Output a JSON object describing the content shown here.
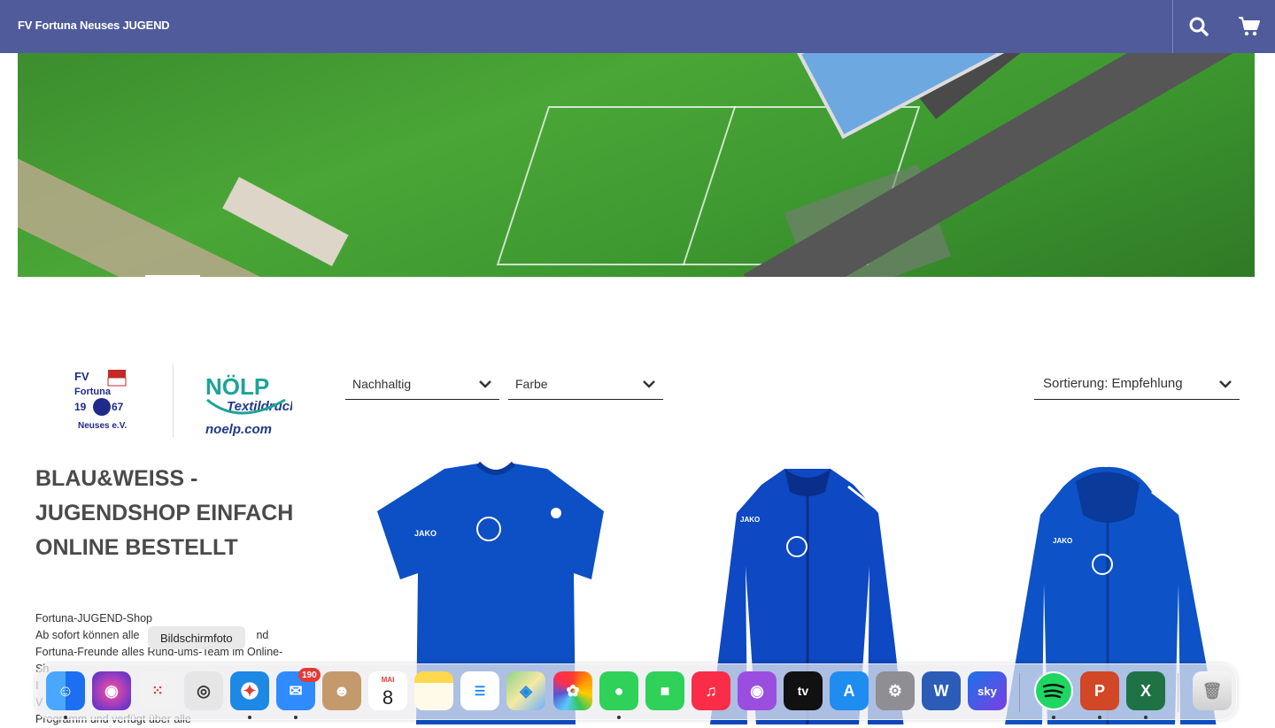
{
  "header": {
    "brand": "FV Fortuna Neuses JUGEND",
    "search_icon": "search-icon",
    "cart_icon": "cart-icon",
    "color": "#505b9c"
  },
  "logos": {
    "club_lines": [
      "FV",
      "Fortuna",
      "19",
      "67",
      "Neuses e.V."
    ],
    "partner_name": "NÖLP",
    "partner_sub": "Textildruck",
    "partner_url": "noelp.com"
  },
  "filters": {
    "nachhaltig": "Nachhaltig",
    "farbe": "Farbe",
    "sort": "Sortierung: Empfehlung"
  },
  "headline": "BLAU&WEISS - JUGENDSHOP EINFACH ONLINE BESTELLT",
  "intro": [
    "Fortuna-JUGEND-Shop",
    "Ab sofort können alle",
    "Fortuna-Freunde alles Rund-ums-Team im Online-",
    "Sh",
    "I",
    "V",
    "Programm und verfügt über alle"
  ],
  "intro_fragments": {
    "line2_tail": "nd",
    "line3_mid": ""
  },
  "products": [
    {
      "kind": "tshirt",
      "brand": "JAKO"
    },
    {
      "kind": "jacket",
      "brand": "JAKO"
    },
    {
      "kind": "hoodie",
      "brand": "JAKO"
    }
  ],
  "tooltip": "Bildschirmfoto",
  "dock": {
    "mail_badge": "190",
    "calendar_month": "MAI",
    "calendar_day": "8",
    "apps": [
      {
        "name": "finder",
        "color": "#2f8cff"
      },
      {
        "name": "siri",
        "color": "#5a3fd0"
      },
      {
        "name": "launchpad",
        "color": "#f2f2f2"
      },
      {
        "name": "screenshot",
        "color": "#eaeaea"
      },
      {
        "name": "safari",
        "color": "#1e88e5"
      },
      {
        "name": "mail",
        "color": "#2f8bff"
      },
      {
        "name": "contacts",
        "color": "#c49a6c"
      },
      {
        "name": "calendar",
        "color": "#ffffff"
      },
      {
        "name": "notes",
        "color": "#ffd84d"
      },
      {
        "name": "reminders",
        "color": "#ffffff"
      },
      {
        "name": "maps",
        "color": "#6cc27a"
      },
      {
        "name": "photos",
        "color": "#ffffff"
      },
      {
        "name": "messages",
        "color": "#2fd158"
      },
      {
        "name": "facetime",
        "color": "#2fd158"
      },
      {
        "name": "music",
        "color": "#fa2d48"
      },
      {
        "name": "podcasts",
        "color": "#9b4de0"
      },
      {
        "name": "appletv",
        "color": "#111111"
      },
      {
        "name": "appstore",
        "color": "#1f8cf0"
      },
      {
        "name": "systemsettings",
        "color": "#8e8e93"
      },
      {
        "name": "word",
        "color": "#2b5cb8"
      },
      {
        "name": "skygo",
        "color": "#1a73e8"
      },
      {
        "name": "spotify",
        "color": "#1ed760"
      },
      {
        "name": "powerpoint",
        "color": "#d24726"
      },
      {
        "name": "excel",
        "color": "#1f7244"
      },
      {
        "name": "trash",
        "color": "#dcdcdc"
      }
    ],
    "labels": {
      "word": "W",
      "powerpoint": "P",
      "excel": "X",
      "skygo": "sky",
      "appletv": "tv"
    }
  }
}
